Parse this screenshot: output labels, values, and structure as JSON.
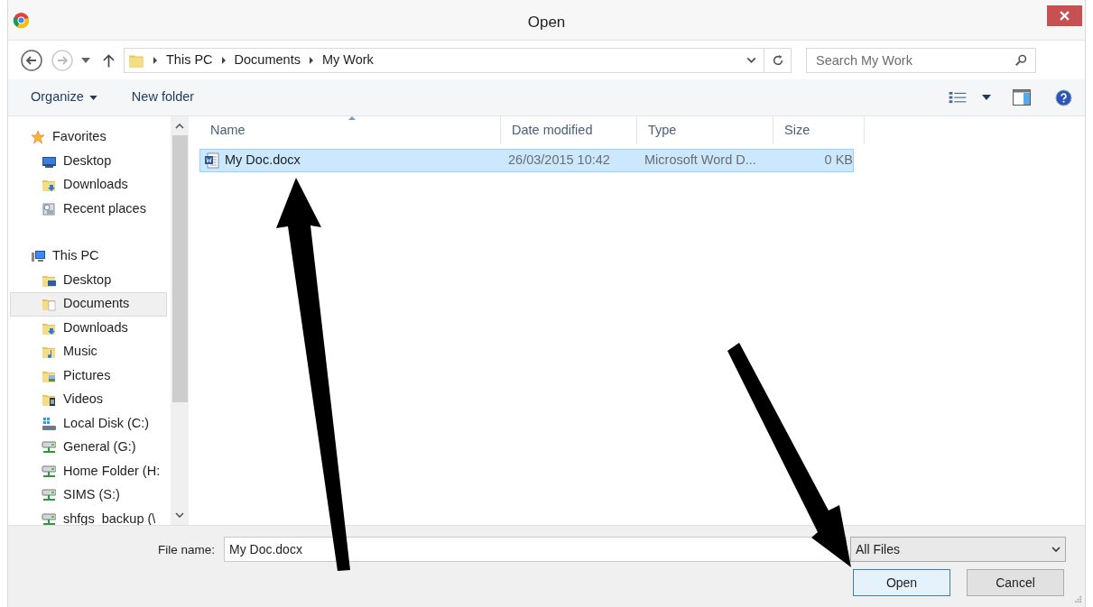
{
  "window": {
    "title": "Open"
  },
  "address": {
    "path": [
      "This PC",
      "Documents",
      "My Work"
    ],
    "search_placeholder": "Search My Work"
  },
  "toolbar": {
    "organize": "Organize",
    "new_folder": "New folder"
  },
  "sidebar": {
    "groups": [
      {
        "label": "Favorites",
        "kind": "star",
        "children": [
          {
            "label": "Desktop",
            "kind": "desktop",
            "selected": false
          },
          {
            "label": "Downloads",
            "kind": "downloads",
            "selected": false
          },
          {
            "label": "Recent places",
            "kind": "recent",
            "selected": false
          }
        ]
      },
      {
        "label": "This PC",
        "kind": "computer",
        "children": [
          {
            "label": "Desktop",
            "kind": "folder",
            "selected": false
          },
          {
            "label": "Documents",
            "kind": "documents",
            "selected": true
          },
          {
            "label": "Downloads",
            "kind": "downloads",
            "selected": false
          },
          {
            "label": "Music",
            "kind": "music",
            "selected": false
          },
          {
            "label": "Pictures",
            "kind": "pictures",
            "selected": false
          },
          {
            "label": "Videos",
            "kind": "videos",
            "selected": false
          },
          {
            "label": "Local Disk (C:)",
            "kind": "disk",
            "selected": false
          },
          {
            "label": "General (G:)",
            "kind": "network",
            "selected": false
          },
          {
            "label": "Home Folder (H:",
            "kind": "network",
            "selected": false
          },
          {
            "label": "SIMS (S:)",
            "kind": "network",
            "selected": false
          },
          {
            "label": "shfgs_backup (\\",
            "kind": "network",
            "selected": false
          }
        ]
      }
    ]
  },
  "table": {
    "columns": [
      "Name",
      "Date modified",
      "Type",
      "Size"
    ],
    "rows": [
      {
        "name": "My Doc.docx",
        "date": "26/03/2015 10:42",
        "type": "Microsoft Word D...",
        "size": "0 KB",
        "selected": true
      }
    ]
  },
  "footer": {
    "file_name_label": "File name:",
    "file_name": "My Doc.docx",
    "file_type": "All Files",
    "buttons": [
      "Open",
      "Cancel"
    ]
  }
}
